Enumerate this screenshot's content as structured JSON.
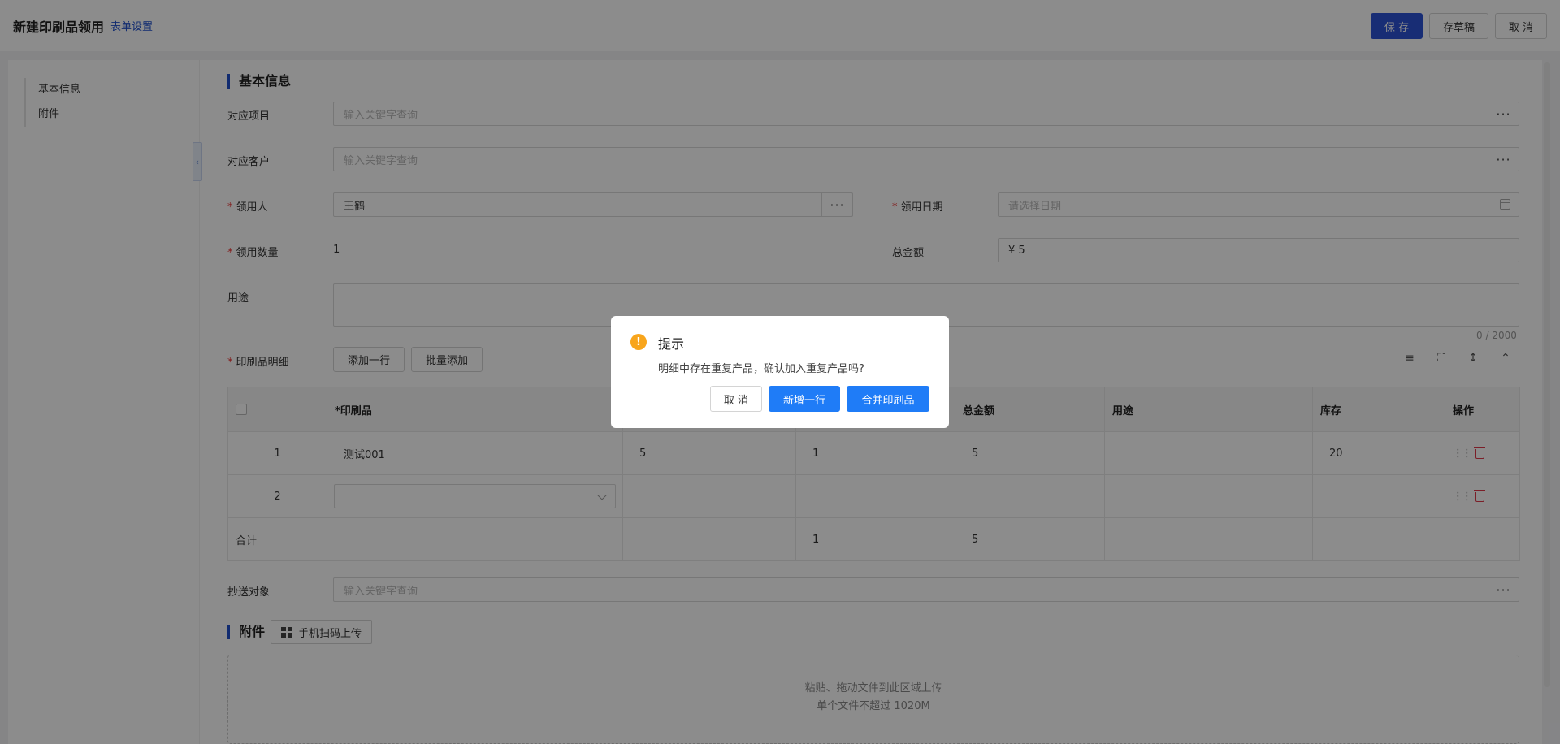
{
  "header": {
    "title": "新建印刷品领用",
    "form_settings": "表单设置",
    "save": "保 存",
    "draft": "存草稿",
    "cancel": "取 消"
  },
  "sidebar": {
    "items": [
      {
        "label": "基本信息"
      },
      {
        "label": "附件"
      }
    ]
  },
  "basic": {
    "section_title": "基本信息",
    "project": {
      "label": "对应项目",
      "placeholder": "输入关键字查询"
    },
    "customer": {
      "label": "对应客户",
      "placeholder": "输入关键字查询"
    },
    "recipient": {
      "label": "领用人",
      "value": "王鹤"
    },
    "date": {
      "label": "领用日期",
      "placeholder": "请选择日期"
    },
    "quantity": {
      "label": "领用数量",
      "value": "1"
    },
    "total": {
      "label": "总金额",
      "value": "¥  5"
    },
    "purpose": {
      "label": "用途",
      "counter": "0 / 2000"
    },
    "detail_label": "印刷品明细",
    "add_row": "添加一行",
    "batch_add": "批量添加"
  },
  "table": {
    "headers": [
      "*印刷品",
      "总金额",
      "用途",
      "库存",
      "操作"
    ],
    "rows": [
      {
        "index": "1",
        "product": "测试001",
        "col3": "5",
        "col4": "1",
        "total": "5",
        "purpose": "",
        "stock": "20"
      },
      {
        "index": "2",
        "product": "",
        "col3": "",
        "col4": "",
        "total": "",
        "purpose": "",
        "stock": ""
      }
    ],
    "footer": {
      "label": "合计",
      "col4": "1",
      "total": "5"
    }
  },
  "cc": {
    "label": "抄送对象",
    "placeholder": "输入关键字查询"
  },
  "attachments": {
    "section_title": "附件",
    "scan_upload": "手机扫码上传",
    "drop_line1": "粘贴、拖动文件到此区域上传",
    "drop_line2": "单个文件不超过 1020M"
  },
  "dialog": {
    "title": "提示",
    "message": "明细中存在重复产品，确认加入重复产品吗?",
    "cancel": "取 消",
    "add_row": "新增一行",
    "merge": "合并印刷品"
  },
  "colors": {
    "primary": "#2c53d6",
    "accent_blue": "#1f7cf7",
    "warning": "#f8a51c",
    "danger": "#e0384a"
  }
}
